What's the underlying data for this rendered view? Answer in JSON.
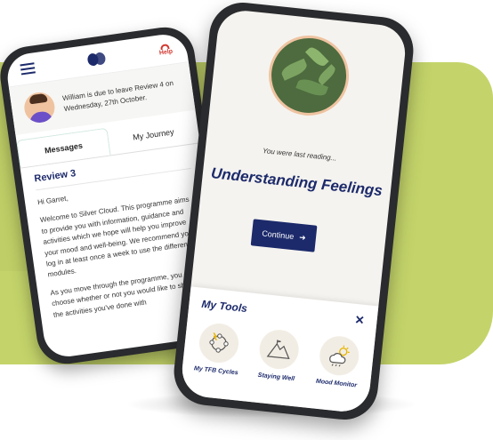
{
  "colors": {
    "accent": "#1c2a6b",
    "background_shape": "#c4d46a",
    "help_red": "#d2372f"
  },
  "left_phone": {
    "header": {
      "menu_icon": "hamburger-icon",
      "logo_icon": "silvercloud-logo-icon",
      "help_label": "Help"
    },
    "notice": "William is due to leave Review 4 on Wednesday, 27th October.",
    "tabs": [
      {
        "label": "Messages",
        "active": true
      },
      {
        "label": "My Journey",
        "active": false
      }
    ],
    "review_title": "Review 3",
    "greeting": "Hi Garret,",
    "paragraphs": [
      "Welcome to Silver Cloud. This programme aims to provide you with information, guidance and activities which we hope will help you improve your mood and well-being. We recommend you log in at least once a week to use the different modules.",
      "As you move through the programme, you can choose whether or not you would like to share the activities you've done with"
    ]
  },
  "right_phone": {
    "last_reading_label": "You were last reading...",
    "module_title": "Understanding Feelings",
    "continue_label": "Continue",
    "tools": {
      "title": "My Tools",
      "close_icon": "close-icon",
      "items": [
        {
          "label": "My TFB Cycles",
          "icon": "cycle-icon"
        },
        {
          "label": "Staying Well",
          "icon": "mountain-icon"
        },
        {
          "label": "Mood Monitor",
          "icon": "weather-icon"
        }
      ]
    }
  }
}
